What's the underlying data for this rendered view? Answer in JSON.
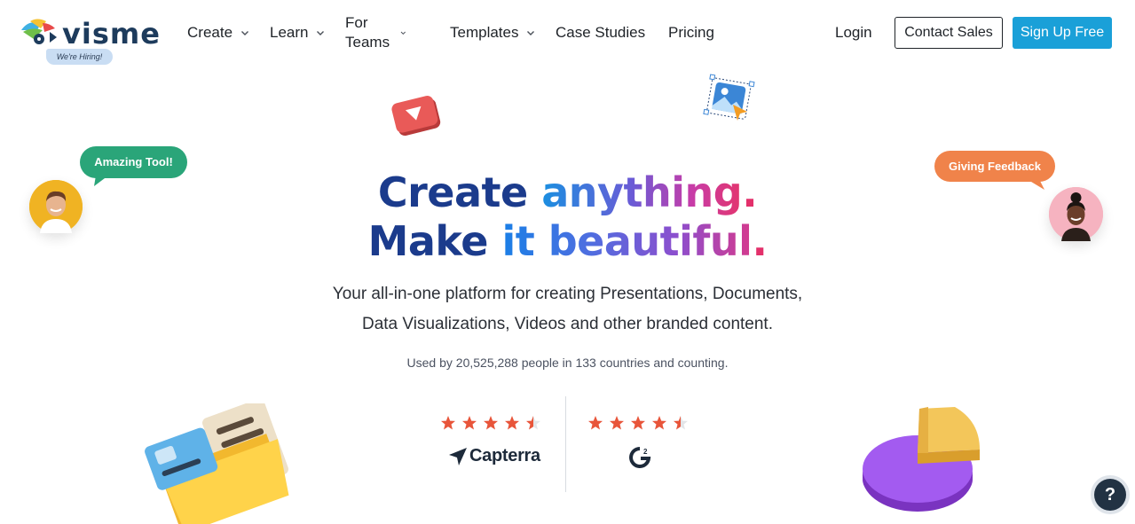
{
  "brand": {
    "name": "visme",
    "hiring_badge": "We're Hiring!"
  },
  "nav": {
    "items": [
      {
        "label": "Create",
        "has_dropdown": true
      },
      {
        "label": "Learn",
        "has_dropdown": true
      },
      {
        "label": "For Teams",
        "has_dropdown": true
      },
      {
        "label": "Templates",
        "has_dropdown": true
      },
      {
        "label": "Case Studies",
        "has_dropdown": false
      },
      {
        "label": "Pricing",
        "has_dropdown": false
      }
    ],
    "login": "Login",
    "contact_sales": "Contact Sales",
    "sign_up": "Sign Up Free"
  },
  "hero": {
    "line1_a": "Create ",
    "line1_b": "anything",
    "line1_dot": ".",
    "line2_a": "Make ",
    "line2_b": "it beautiful",
    "line2_dot": ".",
    "subtitle_line1": "Your all-in-one platform for creating Presentations, Documents,",
    "subtitle_line2": "Data Visualizations, Videos and other branded content.",
    "usage": "Used by 20,525,288 people in 133 countries and counting."
  },
  "ratings": [
    {
      "source": "Capterra",
      "stars": 4.5
    },
    {
      "source": "G2",
      "stars": 4.5
    }
  ],
  "bubbles": {
    "left": "Amazing Tool!",
    "right": "Giving Feedback"
  },
  "help": {
    "label": "?"
  },
  "colors": {
    "primary": "#1aa0d8",
    "navy": "#1b3b8c",
    "star": "#e8553a",
    "bubble_green": "#2aa579",
    "bubble_orange": "#f0834a"
  },
  "icons": {
    "nav_chevron": "chevron-down-icon",
    "rating_star": "star-icon",
    "capterra": "capterra-logo-icon",
    "g2": "g2-logo-icon"
  }
}
